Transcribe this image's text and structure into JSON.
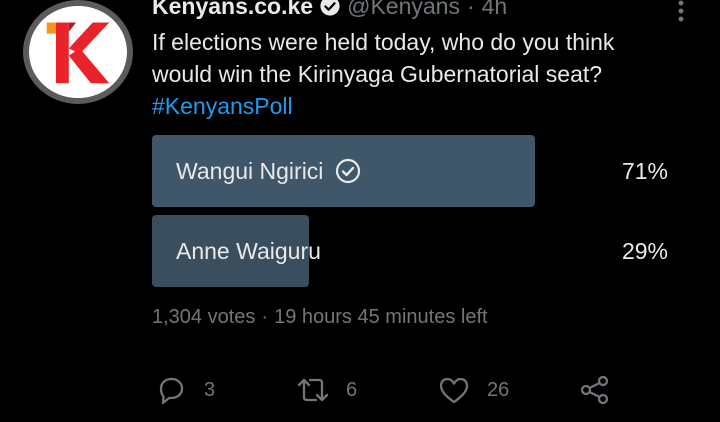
{
  "tweet": {
    "author_name": "Kenyans.co.ke",
    "handle": "@Kenyans",
    "separator": "·",
    "time": "4h",
    "text_line1": "If elections were held today, who do you think",
    "text_line2": "would win the Kirinyaga Gubernatorial seat?",
    "hashtag": "#KenyansPoll"
  },
  "poll": {
    "options": [
      {
        "label": "Wangui Ngirici",
        "percent_label": "71%",
        "percent": 71,
        "winner": true
      },
      {
        "label": "Anne Waiguru",
        "percent_label": "29%",
        "percent": 29,
        "winner": false
      }
    ],
    "votes": "1,304 votes",
    "meta_separator": "·",
    "time_left": "19 hours 45 minutes left"
  },
  "actions": {
    "reply_count": "3",
    "retweet_count": "6",
    "like_count": "26"
  },
  "colors": {
    "background": "#000000",
    "text": "#e7e9ea",
    "muted": "#71767b",
    "hashtag": "#1d9bf0",
    "poll_bar": "#3a4e5d",
    "logo_red": "#e8242a",
    "logo_orange": "#f7931e"
  },
  "icons": [
    "kenyans-logo-icon",
    "verified-badge-icon",
    "more-options-icon",
    "check-circle-icon",
    "reply-icon",
    "retweet-icon",
    "like-icon",
    "share-icon"
  ]
}
